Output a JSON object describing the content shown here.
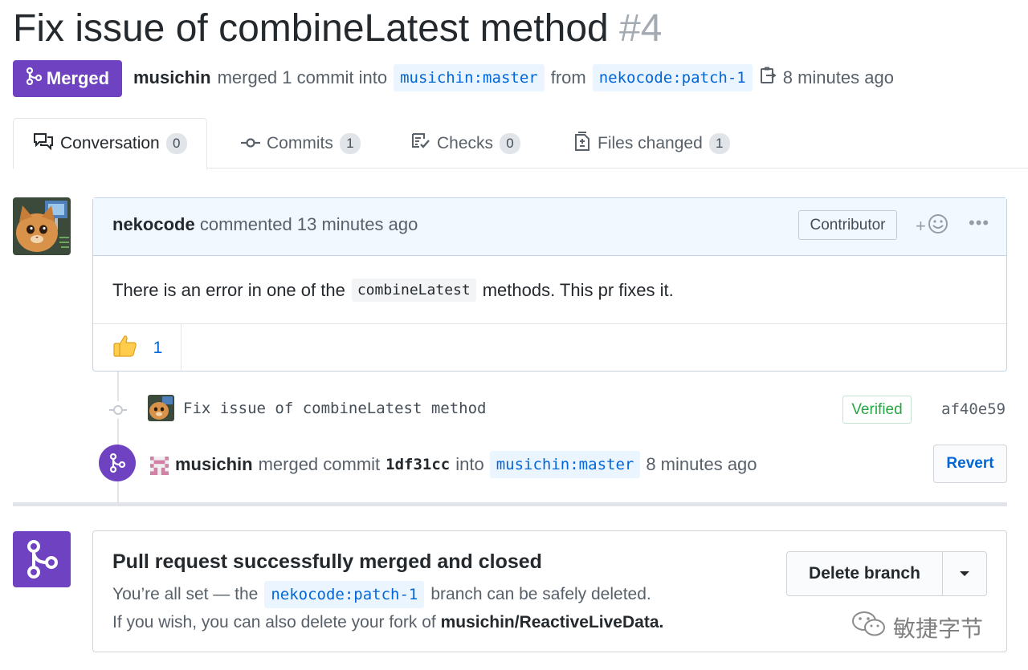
{
  "pr": {
    "title": "Fix issue of combineLatest method",
    "number": "#4",
    "state_label": "Merged",
    "merger": "musichin",
    "merge_phrase": "merged 1 commit into",
    "base_branch": "musichin:master",
    "from_word": "from",
    "head_branch": "nekocode:patch-1",
    "time": "8 minutes ago"
  },
  "tabs": [
    {
      "label": "Conversation",
      "count": "0"
    },
    {
      "label": "Commits",
      "count": "1"
    },
    {
      "label": "Checks",
      "count": "0"
    },
    {
      "label": "Files changed",
      "count": "1"
    }
  ],
  "comment": {
    "author": "nekocode",
    "action": "commented 13 minutes ago",
    "role_badge": "Contributor",
    "body_before": "There is an error in one of the",
    "body_code": "combineLatest",
    "body_after": "methods. This pr fixes it.",
    "reaction_count": "1"
  },
  "commit": {
    "message": "Fix issue of combineLatest method",
    "verified_label": "Verified",
    "sha": "af40e59"
  },
  "merge_event": {
    "user": "musichin",
    "phrase": "merged commit",
    "sha": "1df31cc",
    "into_word": "into",
    "branch": "musichin:master",
    "time": "8 minutes ago",
    "revert_label": "Revert"
  },
  "merged_box": {
    "title": "Pull request successfully merged and closed",
    "line1_before": "You’re all set — the",
    "line1_branch": "nekocode:patch-1",
    "line1_after": "branch can be safely deleted.",
    "line2_before": "If you wish, you can also delete your fork of",
    "line2_repo": "musichin/ReactiveLiveData.",
    "delete_label": "Delete branch"
  },
  "watermark": "敏捷字节",
  "colors": {
    "merged_purple": "#6f42c1",
    "link_blue": "#0366d6",
    "verified_green": "#28a745"
  }
}
